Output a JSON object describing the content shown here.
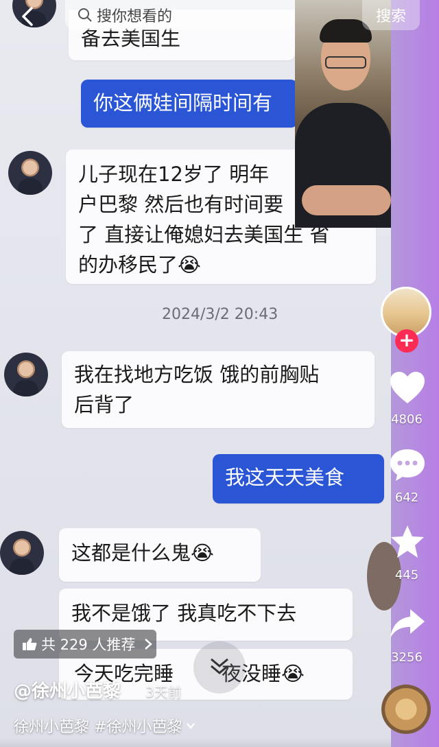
{
  "topbar": {
    "search_placeholder": "搜你想看的",
    "search_button": "搜索"
  },
  "chat": {
    "msg_top_partial": "备去美国生",
    "msg_blue_1": "你这俩娃间隔时间有",
    "msg_2_lines": [
      "儿子现在12岁了 明年",
      "户巴黎 然后也有时间要",
      "了 直接让俺媳妇去美国生 省",
      "的办移民了"
    ],
    "timestamp": "2024/3/2 20:43",
    "msg_3_lines": [
      "我在找地方吃饭 饿的前胸贴",
      "后背了"
    ],
    "msg_blue_2": "我这天天美食",
    "msg_4": "这都是什么鬼",
    "msg_5": "我不是饿了 我真吃不下去",
    "msg_6_partial": "今天吃完睡",
    "msg_6_partial_b": "夜没睡",
    "emoji": "😭"
  },
  "rail": {
    "likes": "4806",
    "comments": "642",
    "favorites": "445",
    "shares": "3256",
    "follow": "+"
  },
  "bottom": {
    "recommend": "共 229 人推荐",
    "author": "@徐州小芭黎",
    "time_ago": "3天前",
    "caption": "徐州小芭黎 #徐州小芭黎"
  },
  "colors": {
    "blue_bubble": "#2a56d6",
    "follow_red": "#fe2c55",
    "rail_purple": "#b77ee6"
  }
}
